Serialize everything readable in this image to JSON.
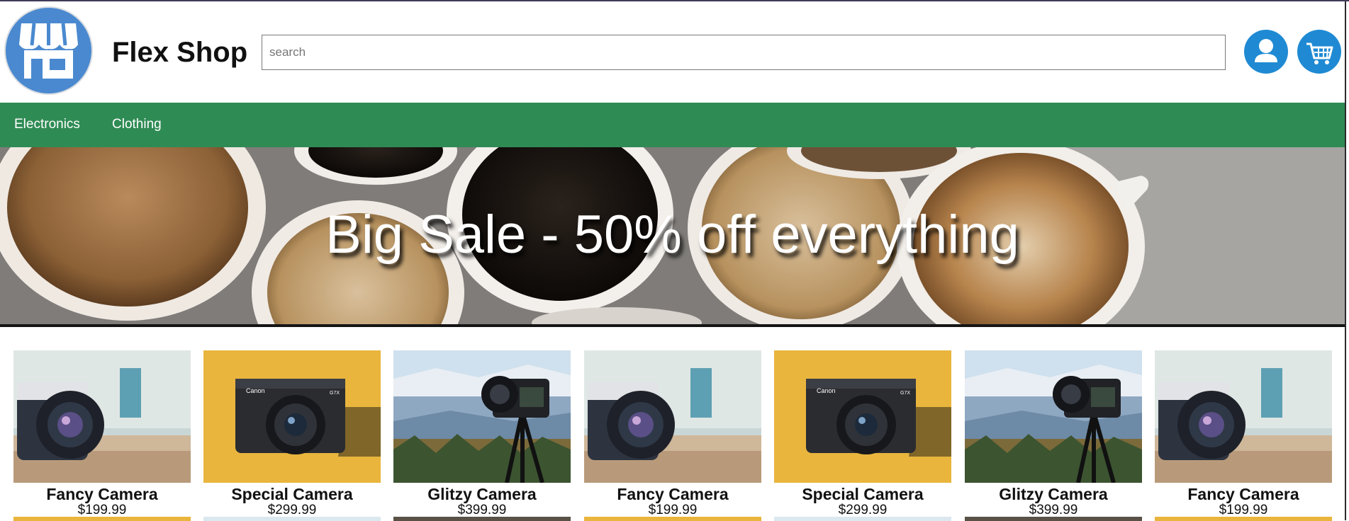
{
  "header": {
    "brand": "Flex Shop",
    "search_placeholder": "search",
    "search_value": "",
    "logo_icon": "storefront-icon",
    "account_icon": "user-icon",
    "cart_icon": "cart-icon"
  },
  "nav": {
    "items": [
      {
        "label": "Electronics"
      },
      {
        "label": "Clothing"
      }
    ]
  },
  "banner": {
    "text": "Big Sale - 50% off everything"
  },
  "products": [
    {
      "name": "Fancy Camera",
      "price": "$199.99",
      "image": "camera-on-table"
    },
    {
      "name": "Special Camera",
      "price": "$299.99",
      "image": "canon-compact-camera"
    },
    {
      "name": "Glitzy Camera",
      "price": "$399.99",
      "image": "camera-on-tripod"
    },
    {
      "name": "Fancy Camera",
      "price": "$199.99",
      "image": "camera-on-table"
    },
    {
      "name": "Special Camera",
      "price": "$299.99",
      "image": "canon-compact-camera"
    },
    {
      "name": "Glitzy Camera",
      "price": "$399.99",
      "image": "camera-on-tripod"
    },
    {
      "name": "Fancy Camera",
      "price": "$199.99",
      "image": "camera-on-table"
    }
  ],
  "colors": {
    "nav_bg": "#2f8b54",
    "logo_bg": "#4a89cf",
    "icon_button_bg": "#1f8ad3",
    "special_bg": "#e9b53d"
  }
}
